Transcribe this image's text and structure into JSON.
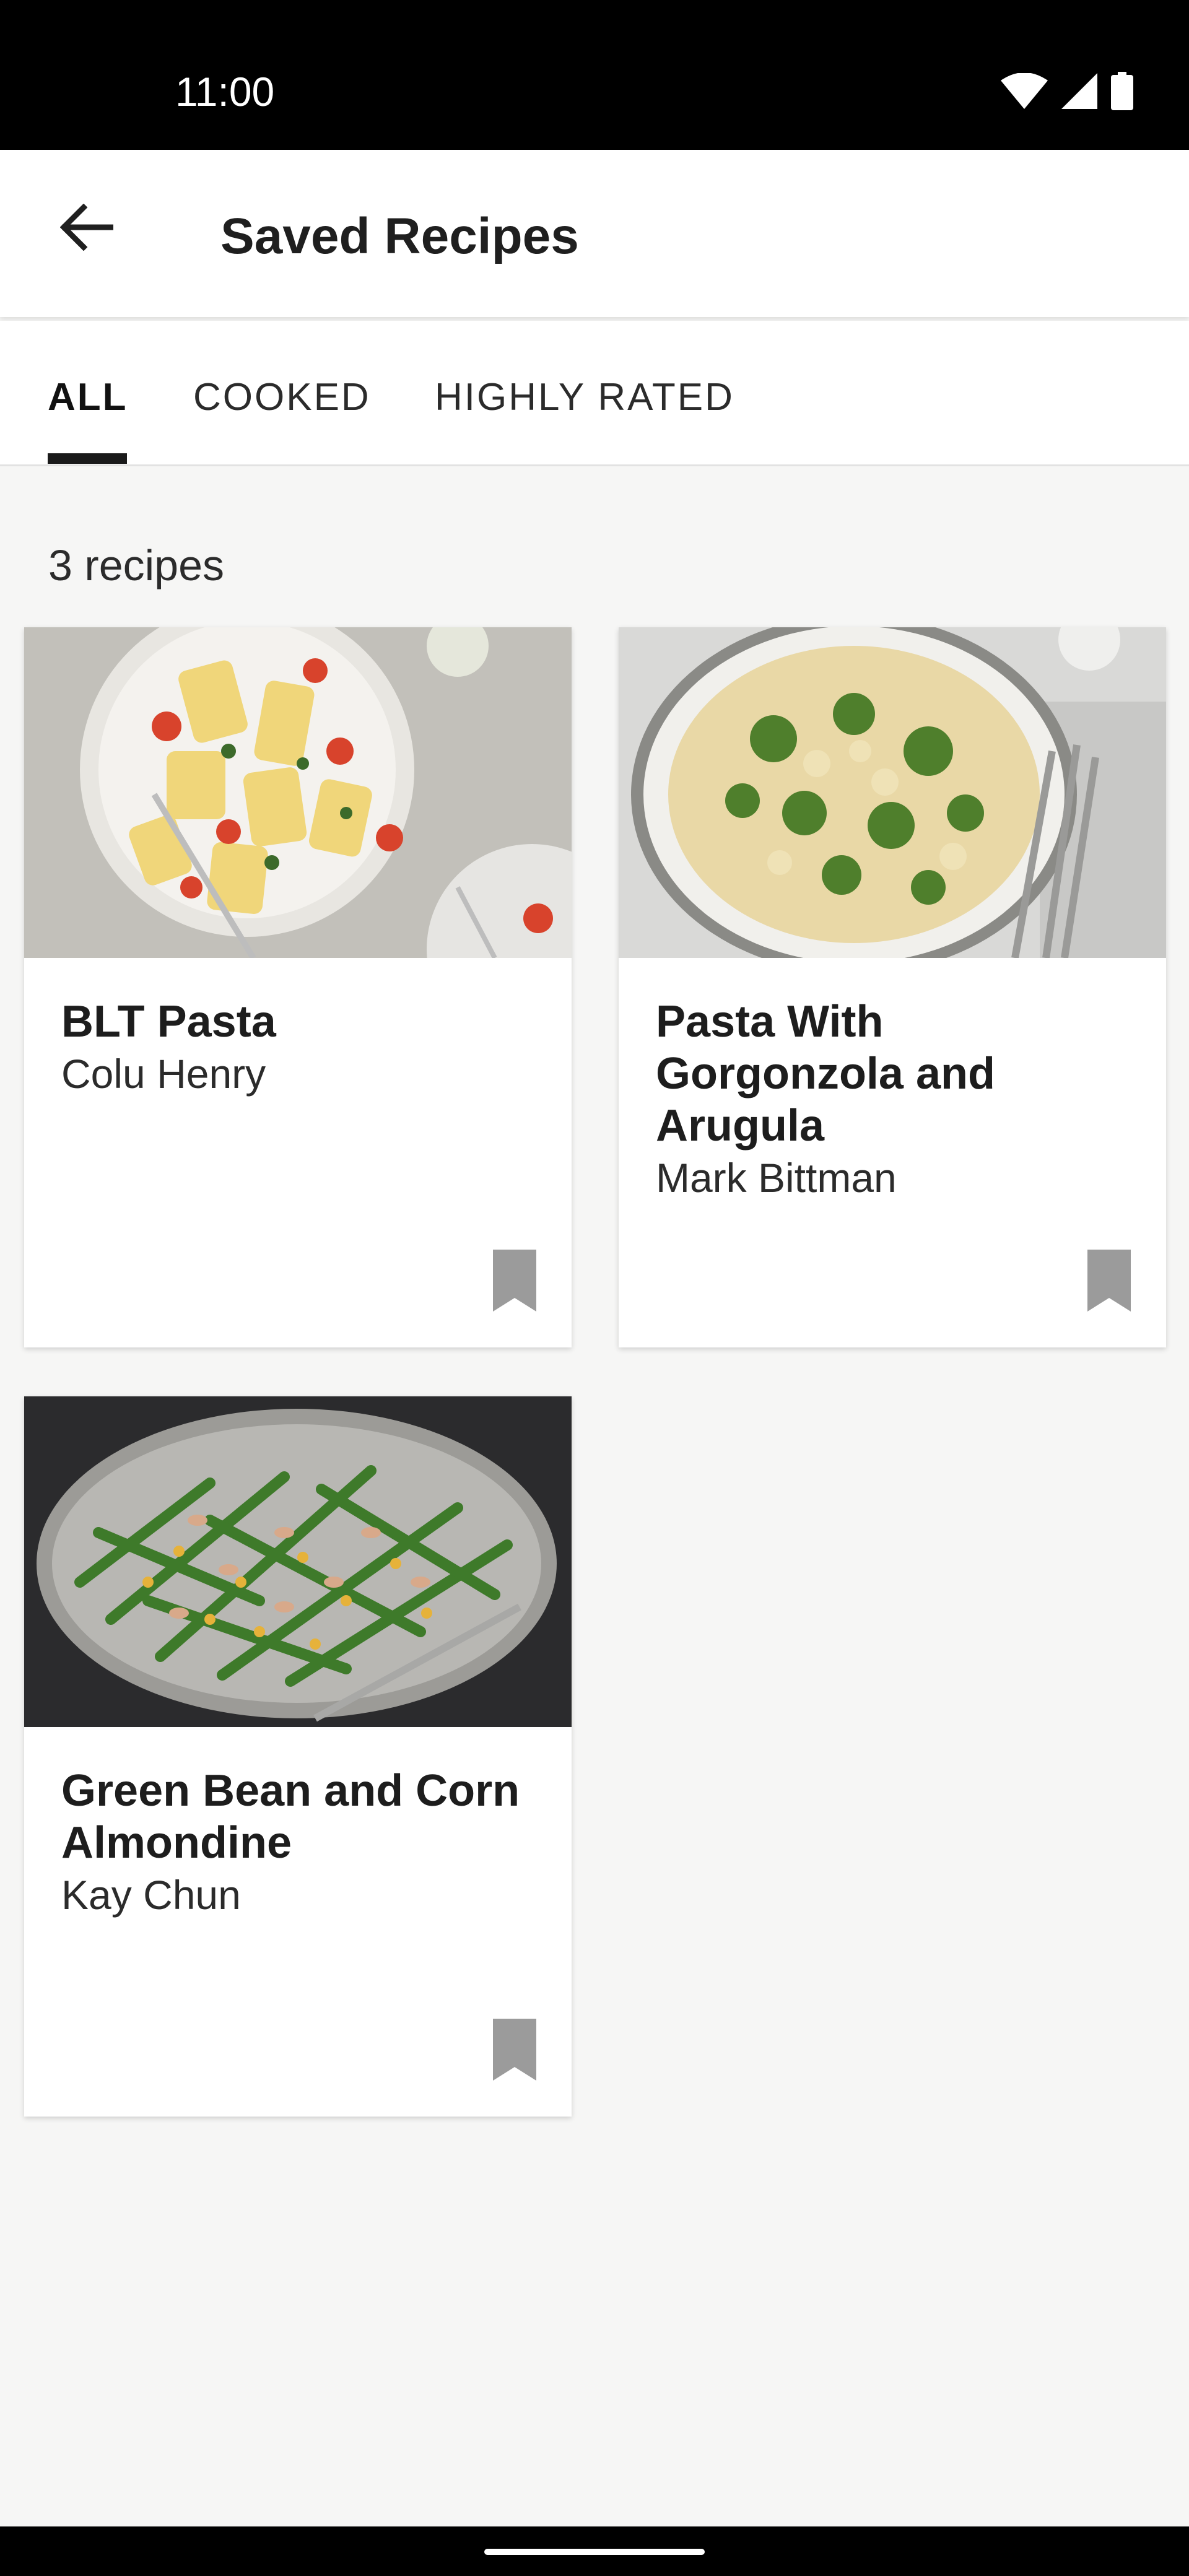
{
  "status_bar": {
    "time": "11:00"
  },
  "app_bar": {
    "title": "Saved Recipes"
  },
  "tabs": [
    {
      "label": "ALL",
      "active": true
    },
    {
      "label": "COOKED",
      "active": false
    },
    {
      "label": "HIGHLY RATED",
      "active": false
    }
  ],
  "recipe_count": "3 recipes",
  "recipes": [
    {
      "title": "BLT Pasta",
      "author": "Colu Henry"
    },
    {
      "title": "Pasta With Gorgonzola and Arugula",
      "author": "Mark Bittman"
    },
    {
      "title": "Green Bean and Corn Almondine",
      "author": "Kay Chun"
    }
  ],
  "colors": {
    "bookmark": "#9b9b9b",
    "background": "#f6f6f5",
    "tab_indicator": "#1a1a1a"
  }
}
